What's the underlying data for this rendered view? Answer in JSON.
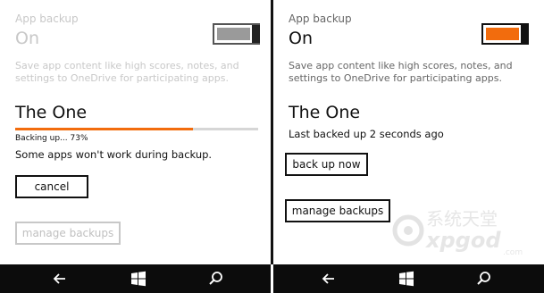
{
  "left": {
    "section_label": "App backup",
    "toggle_state": "On",
    "description": "Save app content like high scores, notes, and settings to OneDrive for participating apps.",
    "item_title": "The One",
    "progress": {
      "text": "Backing up... 73%",
      "value_percent": 73
    },
    "warning": "Some apps won't work during backup.",
    "cancel_label": "cancel",
    "manage_label": "manage backups"
  },
  "right": {
    "section_label": "App backup",
    "toggle_state": "On",
    "description": "Save app content like high scores, notes, and settings to OneDrive for participating apps.",
    "item_title": "The One",
    "status": "Last backed up 2 seconds ago",
    "backup_now_label": "back up now",
    "manage_label": "manage backups"
  },
  "navbar": {
    "icons": [
      "back-icon",
      "windows-icon",
      "search-icon"
    ]
  },
  "watermark": {
    "brand_text": "系统天堂",
    "brand_latin": "xpgod",
    "brand_suffix": ".com"
  },
  "colors": {
    "accent": "#f26c0d",
    "navbar": "#0c0c0c",
    "disabled": "#c8c8c8"
  }
}
